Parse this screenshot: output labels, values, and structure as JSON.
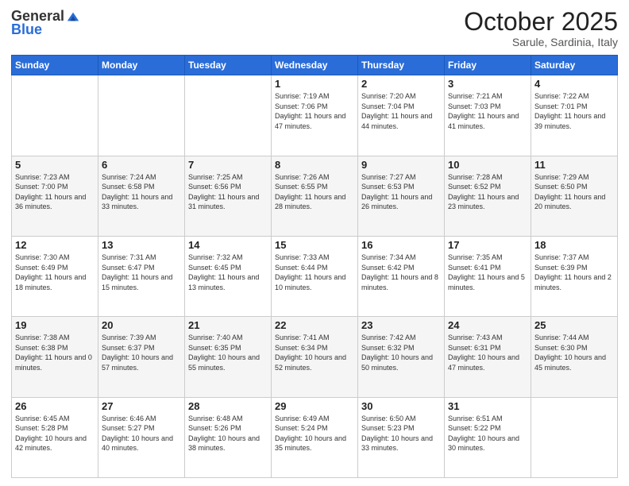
{
  "logo": {
    "general": "General",
    "blue": "Blue"
  },
  "title": "October 2025",
  "subtitle": "Sarule, Sardinia, Italy",
  "days_of_week": [
    "Sunday",
    "Monday",
    "Tuesday",
    "Wednesday",
    "Thursday",
    "Friday",
    "Saturday"
  ],
  "weeks": [
    [
      {
        "day": "",
        "info": ""
      },
      {
        "day": "",
        "info": ""
      },
      {
        "day": "",
        "info": ""
      },
      {
        "day": "1",
        "info": "Sunrise: 7:19 AM\nSunset: 7:06 PM\nDaylight: 11 hours and 47 minutes."
      },
      {
        "day": "2",
        "info": "Sunrise: 7:20 AM\nSunset: 7:04 PM\nDaylight: 11 hours and 44 minutes."
      },
      {
        "day": "3",
        "info": "Sunrise: 7:21 AM\nSunset: 7:03 PM\nDaylight: 11 hours and 41 minutes."
      },
      {
        "day": "4",
        "info": "Sunrise: 7:22 AM\nSunset: 7:01 PM\nDaylight: 11 hours and 39 minutes."
      }
    ],
    [
      {
        "day": "5",
        "info": "Sunrise: 7:23 AM\nSunset: 7:00 PM\nDaylight: 11 hours and 36 minutes."
      },
      {
        "day": "6",
        "info": "Sunrise: 7:24 AM\nSunset: 6:58 PM\nDaylight: 11 hours and 33 minutes."
      },
      {
        "day": "7",
        "info": "Sunrise: 7:25 AM\nSunset: 6:56 PM\nDaylight: 11 hours and 31 minutes."
      },
      {
        "day": "8",
        "info": "Sunrise: 7:26 AM\nSunset: 6:55 PM\nDaylight: 11 hours and 28 minutes."
      },
      {
        "day": "9",
        "info": "Sunrise: 7:27 AM\nSunset: 6:53 PM\nDaylight: 11 hours and 26 minutes."
      },
      {
        "day": "10",
        "info": "Sunrise: 7:28 AM\nSunset: 6:52 PM\nDaylight: 11 hours and 23 minutes."
      },
      {
        "day": "11",
        "info": "Sunrise: 7:29 AM\nSunset: 6:50 PM\nDaylight: 11 hours and 20 minutes."
      }
    ],
    [
      {
        "day": "12",
        "info": "Sunrise: 7:30 AM\nSunset: 6:49 PM\nDaylight: 11 hours and 18 minutes."
      },
      {
        "day": "13",
        "info": "Sunrise: 7:31 AM\nSunset: 6:47 PM\nDaylight: 11 hours and 15 minutes."
      },
      {
        "day": "14",
        "info": "Sunrise: 7:32 AM\nSunset: 6:45 PM\nDaylight: 11 hours and 13 minutes."
      },
      {
        "day": "15",
        "info": "Sunrise: 7:33 AM\nSunset: 6:44 PM\nDaylight: 11 hours and 10 minutes."
      },
      {
        "day": "16",
        "info": "Sunrise: 7:34 AM\nSunset: 6:42 PM\nDaylight: 11 hours and 8 minutes."
      },
      {
        "day": "17",
        "info": "Sunrise: 7:35 AM\nSunset: 6:41 PM\nDaylight: 11 hours and 5 minutes."
      },
      {
        "day": "18",
        "info": "Sunrise: 7:37 AM\nSunset: 6:39 PM\nDaylight: 11 hours and 2 minutes."
      }
    ],
    [
      {
        "day": "19",
        "info": "Sunrise: 7:38 AM\nSunset: 6:38 PM\nDaylight: 11 hours and 0 minutes."
      },
      {
        "day": "20",
        "info": "Sunrise: 7:39 AM\nSunset: 6:37 PM\nDaylight: 10 hours and 57 minutes."
      },
      {
        "day": "21",
        "info": "Sunrise: 7:40 AM\nSunset: 6:35 PM\nDaylight: 10 hours and 55 minutes."
      },
      {
        "day": "22",
        "info": "Sunrise: 7:41 AM\nSunset: 6:34 PM\nDaylight: 10 hours and 52 minutes."
      },
      {
        "day": "23",
        "info": "Sunrise: 7:42 AM\nSunset: 6:32 PM\nDaylight: 10 hours and 50 minutes."
      },
      {
        "day": "24",
        "info": "Sunrise: 7:43 AM\nSunset: 6:31 PM\nDaylight: 10 hours and 47 minutes."
      },
      {
        "day": "25",
        "info": "Sunrise: 7:44 AM\nSunset: 6:30 PM\nDaylight: 10 hours and 45 minutes."
      }
    ],
    [
      {
        "day": "26",
        "info": "Sunrise: 6:45 AM\nSunset: 5:28 PM\nDaylight: 10 hours and 42 minutes."
      },
      {
        "day": "27",
        "info": "Sunrise: 6:46 AM\nSunset: 5:27 PM\nDaylight: 10 hours and 40 minutes."
      },
      {
        "day": "28",
        "info": "Sunrise: 6:48 AM\nSunset: 5:26 PM\nDaylight: 10 hours and 38 minutes."
      },
      {
        "day": "29",
        "info": "Sunrise: 6:49 AM\nSunset: 5:24 PM\nDaylight: 10 hours and 35 minutes."
      },
      {
        "day": "30",
        "info": "Sunrise: 6:50 AM\nSunset: 5:23 PM\nDaylight: 10 hours and 33 minutes."
      },
      {
        "day": "31",
        "info": "Sunrise: 6:51 AM\nSunset: 5:22 PM\nDaylight: 10 hours and 30 minutes."
      },
      {
        "day": "",
        "info": ""
      }
    ]
  ]
}
